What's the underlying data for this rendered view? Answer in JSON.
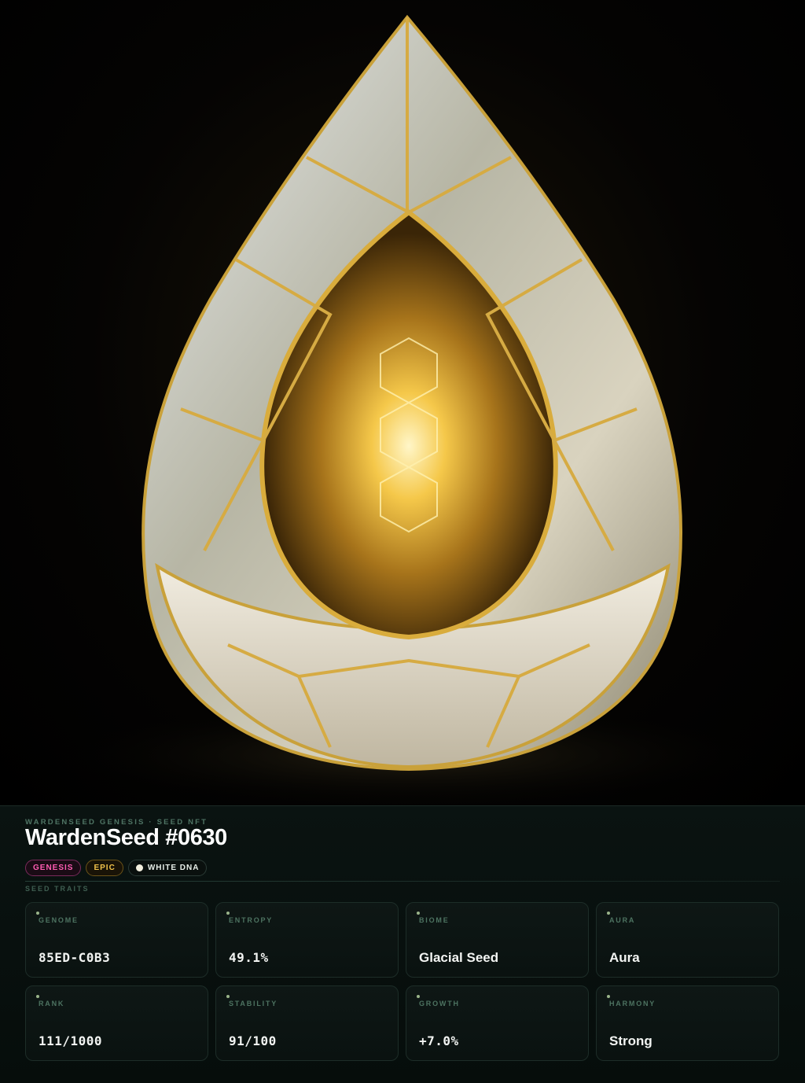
{
  "hero": {
    "image_desc": "crystal-seed-egg"
  },
  "header": {
    "eyebrow": "WARDENSEED GENESIS · SEED NFT",
    "title": "WardenSeed #0630"
  },
  "badges": [
    {
      "label": "GENESIS",
      "color": "#ff5cb3"
    },
    {
      "label": "EPIC",
      "color": "#f1c24a"
    },
    {
      "label": "WHITE DNA",
      "color": "#e8efe9"
    }
  ],
  "traits": {
    "section_label": "SEED TRAITS",
    "items": [
      {
        "label": "GENOME",
        "value": "85ED-C0B3"
      },
      {
        "label": "ENTROPY",
        "value": "49.1%"
      },
      {
        "label": "BIOME",
        "value": "Glacial Seed"
      },
      {
        "label": "AURA",
        "value": "Aura"
      },
      {
        "label": "RANK",
        "value": "111/1000"
      },
      {
        "label": "STABILITY",
        "value": "91/100"
      },
      {
        "label": "GROWTH",
        "value": "+7.0%"
      },
      {
        "label": "HARMONY",
        "value": "Strong"
      }
    ]
  }
}
